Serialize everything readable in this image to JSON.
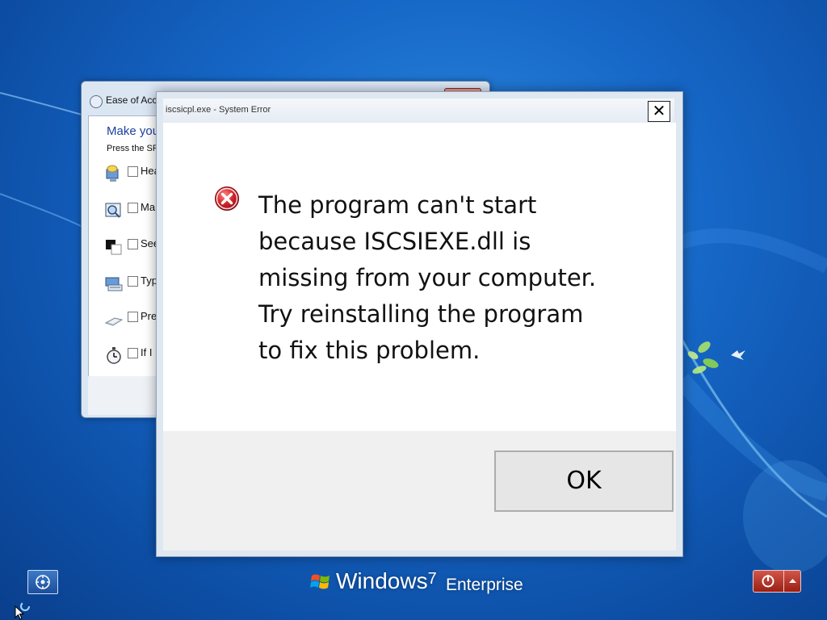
{
  "desktop": {
    "brand": {
      "windows": "Windows",
      "version": "7",
      "edition": "Enterprise"
    }
  },
  "ease_of_access_window": {
    "title": "Ease of Acce",
    "heading": "Make you",
    "subtitle": "Press the SP",
    "items": [
      {
        "label": "Hea",
        "icon": "narrator-icon"
      },
      {
        "label": "Ma",
        "icon": "magnifier-icon"
      },
      {
        "label": "See",
        "icon": "high-contrast-icon"
      },
      {
        "label": "Typ",
        "icon": "on-screen-keyboard-icon"
      },
      {
        "label": "Pre",
        "icon": "keyboard-keys-icon"
      },
      {
        "label": "If I",
        "icon": "stopwatch-icon"
      }
    ]
  },
  "error_dialog": {
    "title": "iscsicpl.exe - System Error",
    "close_glyph": "✕",
    "message_lines": [
      "The program can't start",
      "because ISCSIEXE.dll is",
      "missing from your computer.",
      "Try reinstalling the program",
      "to fix this problem."
    ],
    "ok_label": "OK",
    "icon": "error-icon"
  },
  "colors": {
    "error_red": "#d1222a",
    "desktop_blue": "#1667c7",
    "heading_blue": "#1e3e9e"
  }
}
